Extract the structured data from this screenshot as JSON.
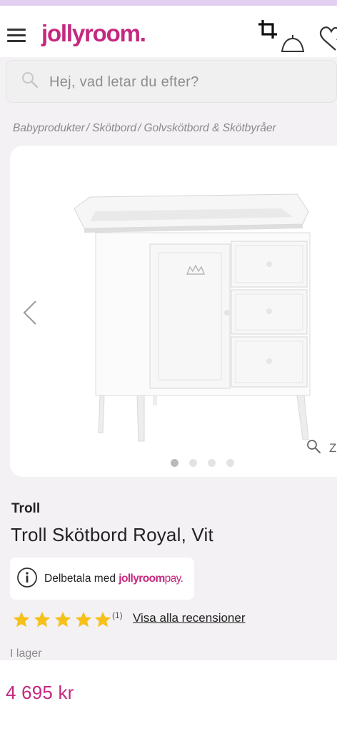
{
  "header": {
    "logo_text": "jollyroom.",
    "icons": [
      "menu-icon",
      "crop-icon",
      "cart-icon",
      "heart-icon"
    ]
  },
  "search": {
    "placeholder": "Hej, vad letar du efter?"
  },
  "breadcrumb": [
    "Babyprodukter",
    "Skötbord",
    "Golvskötbord & Skötbyråer"
  ],
  "breadcrumb_separator": "/",
  "gallery": {
    "image_count": 4,
    "active_index": 0,
    "zoom_label": "Z"
  },
  "product": {
    "brand": "Troll",
    "title": "Troll Skötbord Royal, Vit",
    "rating": 5,
    "review_count": "(1)",
    "review_link": "Visa alla recensioner",
    "stock": "I lager",
    "price": "4 695 kr"
  },
  "payment": {
    "text": "Delbetala med",
    "brand_main": "jollyroom",
    "brand_suffix": "pay."
  },
  "colors": {
    "brand": "#c5287f",
    "star": "#f6c01a",
    "top_strip": "#e3cff1",
    "background": "#f3f1f3"
  }
}
